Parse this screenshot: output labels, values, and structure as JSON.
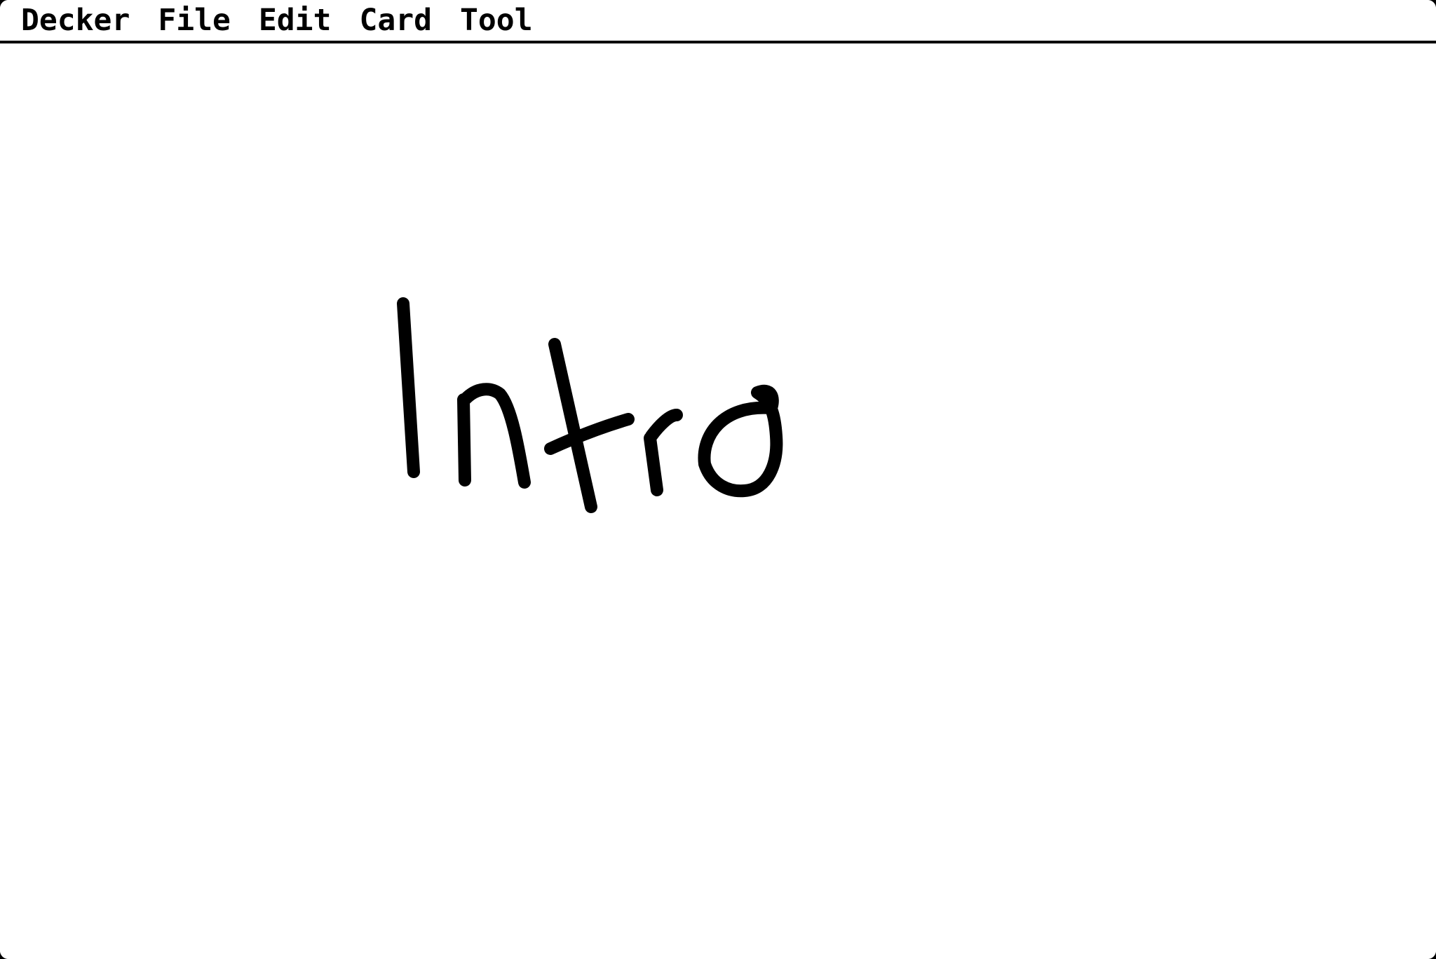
{
  "app": {
    "name": "Decker"
  },
  "menubar": {
    "items": [
      {
        "label": "Decker"
      },
      {
        "label": "File"
      },
      {
        "label": "Edit"
      },
      {
        "label": "Card"
      },
      {
        "label": "Tool"
      }
    ]
  },
  "card": {
    "drawing_text": "Intro"
  },
  "colors": {
    "background": "#ffffff",
    "ink": "#000000"
  }
}
